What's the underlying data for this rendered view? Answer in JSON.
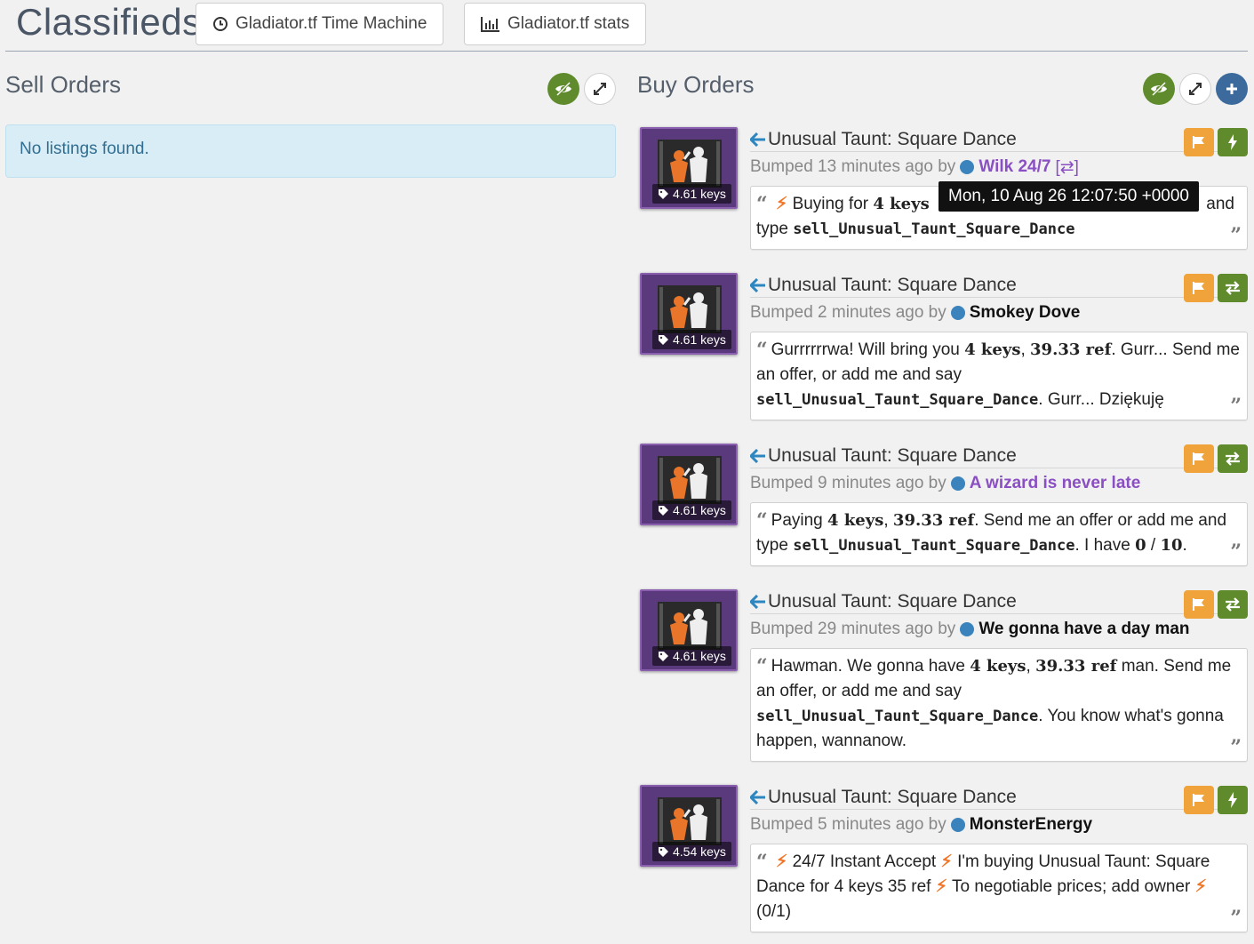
{
  "header": {
    "brand": "Classifieds",
    "btn_time_machine": "Gladiator.tf Time Machine",
    "btn_stats": "Gladiator.tf stats"
  },
  "sell": {
    "title": "Sell Orders",
    "empty": "No listings found."
  },
  "buy": {
    "title": "Buy Orders"
  },
  "tooltip": "Mon, 10 Aug 26 12:07:50 +0000",
  "listings": [
    {
      "title": "Unusual Taunt: Square Dance",
      "price": "4.61 keys",
      "bumped": "Bumped 13 minutes ago by",
      "user": "Wilk 24/7",
      "user_suffix": "[⇄]",
      "comment_a": "Buying for",
      "comment_b": "4 keys",
      "comment_c": "and",
      "comment_d": "type",
      "comment_e": "sell_Unusual_Taunt_Square_Dance"
    },
    {
      "title": "Unusual Taunt: Square Dance",
      "price": "4.61 keys",
      "bumped": "Bumped 2 minutes ago by",
      "user": "Smokey Dove",
      "comment_a": "Gurrrrrrwa! Will bring you",
      "comment_b": "4 keys",
      "comment_c": ",",
      "comment_d": "39.33 ref",
      "comment_e": ". Gurr... Send me an offer, or add me and say",
      "comment_f": "sell_Unusual_Taunt_Square_Dance",
      "comment_g": ". Gurr... Dziękuję"
    },
    {
      "title": "Unusual Taunt: Square Dance",
      "price": "4.61 keys",
      "bumped": "Bumped 9 minutes ago by",
      "user": "A wizard is never late",
      "comment_a": "Paying",
      "comment_b": "4 keys",
      "comment_c": ",",
      "comment_d": "39.33 ref",
      "comment_e": ". Send me an offer or add me and type",
      "comment_f": "sell_Unusual_Taunt_Square_Dance",
      "comment_g": ". I have",
      "comment_h": "0",
      "comment_i": "/",
      "comment_j": "10",
      "comment_k": "."
    },
    {
      "title": "Unusual Taunt: Square Dance",
      "price": "4.61 keys",
      "bumped": "Bumped 29 minutes ago by",
      "user": "We gonna have a day man",
      "comment_a": "Hawman. We gonna have",
      "comment_b": "4 keys",
      "comment_c": ",",
      "comment_d": "39.33 ref",
      "comment_e": "man. Send me an offer, or add me and say",
      "comment_f": "sell_Unusual_Taunt_Square_Dance",
      "comment_g": ". You know what's gonna happen, wannanow."
    },
    {
      "title": "Unusual Taunt: Square Dance",
      "price": "4.54 keys",
      "bumped": "Bumped 5 minutes ago by",
      "user": "MonsterEnergy",
      "comment_a": "24/7 Instant Accept",
      "comment_b": "I'm buying Unusual Taunt: Square Dance for 4 keys 35 ref",
      "comment_c": "To negotiable prices; add owner",
      "comment_d": "(0/1)"
    }
  ],
  "colors": {
    "accent_blue": "#2e86c1",
    "action_green": "#5f8b2d",
    "action_orange": "#f0a33a",
    "item_purple": "#5a3a7d"
  }
}
